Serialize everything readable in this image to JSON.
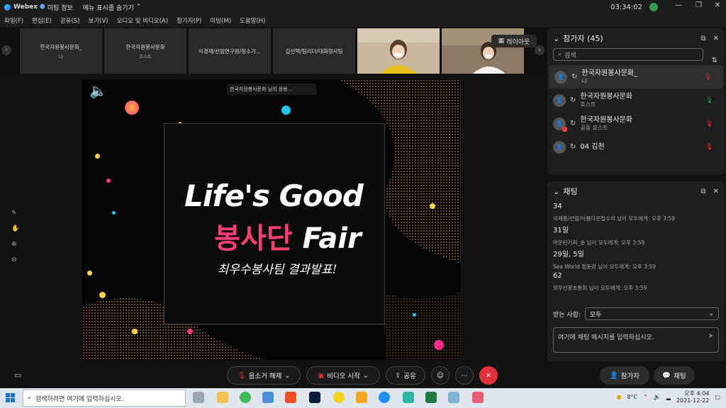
{
  "titlebar": {
    "app": "Webex",
    "meeting_info": "미팅 정보",
    "hide_menu": "메뉴 표시줄 숨기기",
    "time": "03:34:02"
  },
  "menubar": {
    "items": [
      "파일(F)",
      "편집(E)",
      "공유(S)",
      "보기(V)",
      "오디오 및 비디오(A)",
      "참가자(P)",
      "미팅(M)",
      "도움말(H)"
    ]
  },
  "strip": {
    "tiles": [
      {
        "name": "한국자원봉사문화_",
        "sub": "나"
      },
      {
        "name": "한국자원봉사문화",
        "sub": "호스트"
      },
      {
        "name": "이경재/선임연구원/청소기...",
        "sub": ""
      },
      {
        "name": "김선택/팀리더/대화형사팀",
        "sub": ""
      }
    ],
    "layout_label": "레이아웃"
  },
  "share": {
    "notification": "한국자원봉사문화 님의 응용...",
    "line1": "Life's Good",
    "line2_kr": "봉사단",
    "line2_en": "Fair",
    "line3": "최우수봉사팀 결과발표!"
  },
  "participants": {
    "title": "참가자 (45)",
    "search_placeholder": "검색",
    "items": [
      {
        "name": "한국자원봉사문화_",
        "role": "나"
      },
      {
        "name": "한국자원봉사문화",
        "role": "호스트"
      },
      {
        "name": "한국자원봉사문화",
        "role": "공동 호스트"
      },
      {
        "name": "04 김천",
        "role": ""
      }
    ]
  },
  "chat": {
    "title": "채팅",
    "messages": [
      {
        "meta": "",
        "text": "34"
      },
      {
        "meta": "이재홍/선임/아름다운집수리 님이 모두에게:    오후 3:59",
        "text": "31일"
      },
      {
        "meta": "마운틴키퍼_송 님이 모두에게:    오후 3:59",
        "text": "29일, 5일"
      },
      {
        "meta": "Sea World 정동광 님이 모두에게:    오후 3:59",
        "text": "62"
      },
      {
        "meta": "외무선봉초통회 님이 모두에게:    오후 3:59",
        "text": ""
      }
    ],
    "to_label": "받는 사람:",
    "to_value": "모두",
    "input_placeholder": "여기에 채팅 메시지를 입력하십시오."
  },
  "toolbar": {
    "unmute": "음소거 해제",
    "start_video": "비디오 시작",
    "share": "공유",
    "participants": "참가자",
    "chat": "채팅"
  },
  "taskbar": {
    "search_placeholder": "검색하려면 여기에 입력하십시오.",
    "weather": "8°C",
    "time": "오후 4:04",
    "date": "2021-12-22"
  },
  "colors": {
    "accent_pink": "#ff3f73",
    "end_red": "#e3313b",
    "mic_green": "#2e9b4e"
  }
}
